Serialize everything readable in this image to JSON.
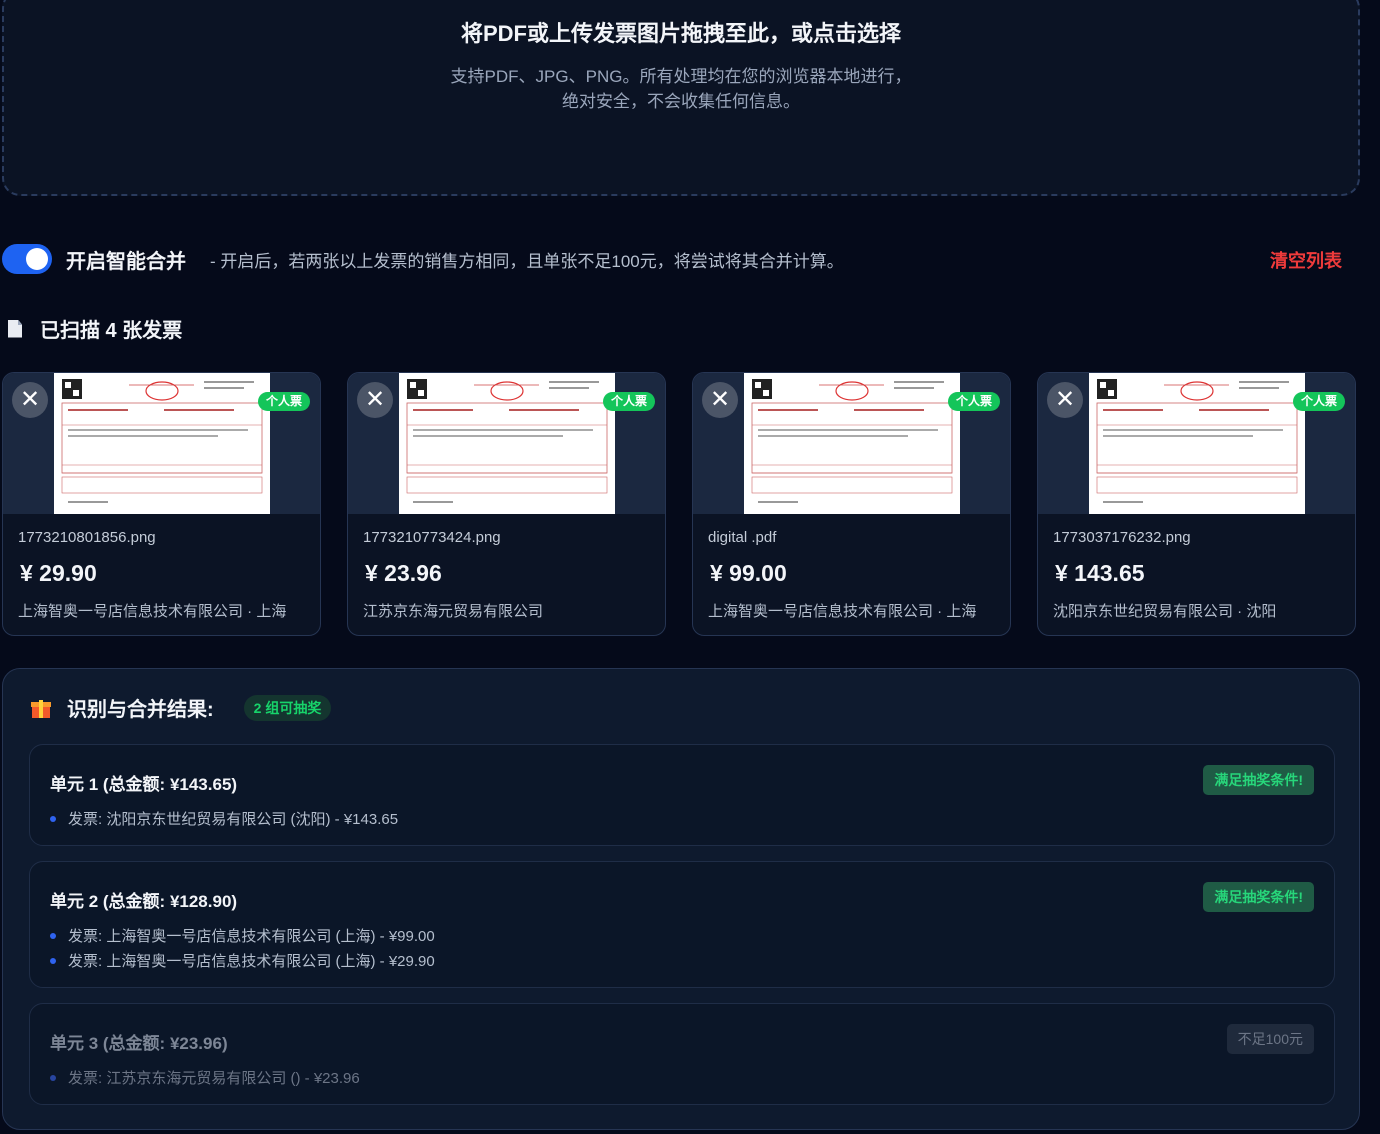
{
  "dropzone": {
    "title": "将PDF或上传发票图片拖拽至此，或点击选择",
    "subtitle_line1": "支持PDF、JPG、PNG。所有处理均在您的浏览器本地进行，",
    "subtitle_line2": "绝对安全，不会收集任何信息。"
  },
  "merge": {
    "enabled": true,
    "label": "开启智能合并",
    "description": "- 开启后，若两张以上发票的销售方相同，且单张不足100元，将尝试将其合并计算。",
    "clear_label": "清空列表"
  },
  "scanned": {
    "title": "已扫描 4 张发票"
  },
  "invoices": [
    {
      "filename": "1773210801856.png",
      "amount": "¥ 29.90",
      "seller": "上海智奥一号店信息技术有限公司 · 上海",
      "badge": "个人票",
      "close": "✕"
    },
    {
      "filename": "1773210773424.png",
      "amount": "¥ 23.96",
      "seller": "江苏京东海元贸易有限公司",
      "badge": "个人票",
      "close": "✕"
    },
    {
      "filename": "digital                          .pdf",
      "amount": "¥ 99.00",
      "seller": "上海智奥一号店信息技术有限公司 · 上海",
      "badge": "个人票",
      "close": "✕"
    },
    {
      "filename": "1773037176232.png",
      "amount": "¥ 143.65",
      "seller": "沈阳京东世纪贸易有限公司 · 沈阳",
      "badge": "个人票",
      "close": "✕"
    }
  ],
  "results": {
    "title": "识别与合并结果:",
    "badge": "2 组可抽奖",
    "units": [
      {
        "title": "单元 1 (总金额: ¥143.65)",
        "status": "满足抽奖条件!",
        "items": [
          "发票: 沈阳京东世纪贸易有限公司 (沈阳) - ¥143.65"
        ]
      },
      {
        "title": "单元 2 (总金额: ¥128.90)",
        "status": "满足抽奖条件!",
        "items": [
          "发票: 上海智奥一号店信息技术有限公司 (上海) - ¥99.00",
          "发票: 上海智奥一号店信息技术有限公司 (上海) - ¥29.90"
        ]
      },
      {
        "title": "单元 3 (总金额: ¥23.96)",
        "status": "不足100元",
        "items": [
          "发票: 江苏京东海元贸易有限公司 () - ¥23.96"
        ]
      }
    ]
  },
  "colors": {
    "background": "#050a1a",
    "accent_blue": "#1e63f2",
    "badge_green": "#14c55a",
    "clear_red": "#ef3b3b"
  }
}
